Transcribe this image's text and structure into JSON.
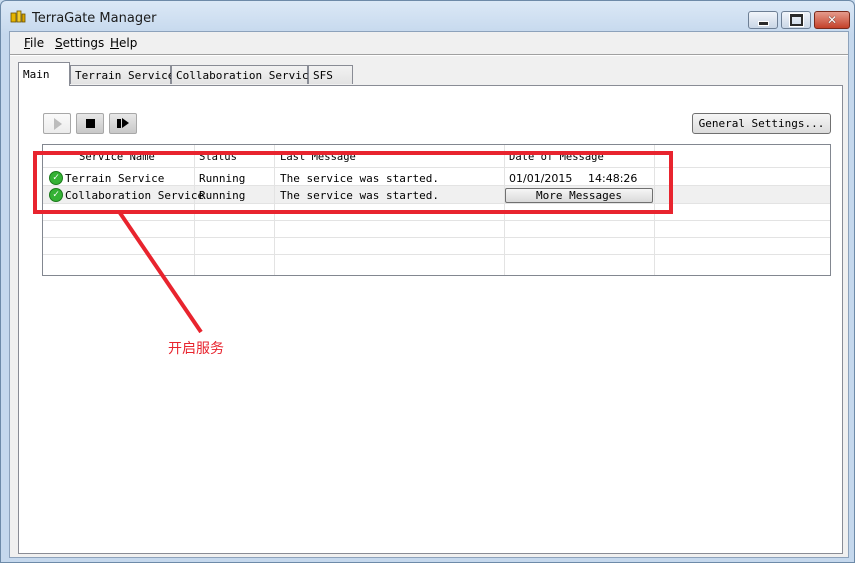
{
  "window": {
    "title": "TerraGate Manager"
  },
  "menu": [
    {
      "key": "F",
      "rest": "ile"
    },
    {
      "key": "S",
      "rest": "ettings"
    },
    {
      "key": "H",
      "rest": "elp"
    }
  ],
  "tabs": [
    "Main",
    "Terrain Service",
    "Collaboration Service",
    "SFS"
  ],
  "toolbar": {
    "general_settings": "General Settings..."
  },
  "grid": {
    "columns": [
      "Service Name",
      "Status",
      "Last Message",
      "Date of Message"
    ],
    "rows": [
      {
        "name": "Terrain Service",
        "status": "Running",
        "message": "The service was started.",
        "date": "01/01/2015",
        "time": "14:48:26"
      },
      {
        "name": "Collaboration Service",
        "status": "Running",
        "message": "The service was started.",
        "action": "More Messages"
      }
    ]
  },
  "annotation": {
    "text": "开启服务",
    "color": "#e8242e"
  }
}
